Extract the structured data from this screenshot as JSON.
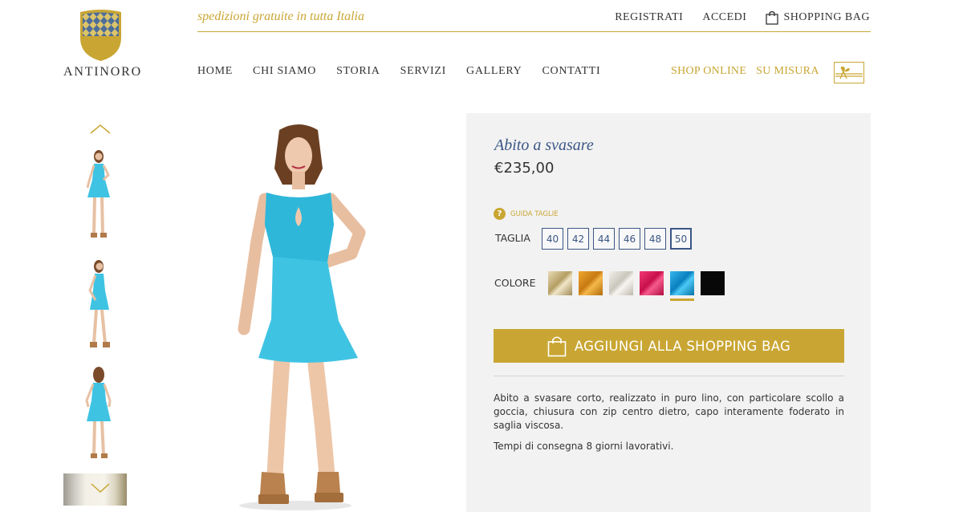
{
  "brand": {
    "name": "ANTINORO"
  },
  "topbar": {
    "promo": "spedizioni gratuite in tutta Italia",
    "links": {
      "register": "REGISTRATI",
      "login": "ACCEDI",
      "bag": "SHOPPING BAG"
    }
  },
  "nav": {
    "items": [
      "HOME",
      "CHI SIAMO",
      "STORIA",
      "SERVIZI",
      "GALLERY",
      "CONTATTI"
    ],
    "right": [
      "SHOP ONLINE",
      "SU MISURA"
    ],
    "gift_icon": "gift-icon"
  },
  "thumbnails": {
    "up_icon": "chevron-up-icon",
    "down_icon": "chevron-down-icon",
    "items": [
      "front-view",
      "side-view",
      "back-view",
      "fabric-detail"
    ]
  },
  "product": {
    "title": "Abito a svasare",
    "price": "€235,00",
    "size_guide": "GUIDA TAGLIE",
    "size_label": "TAGLIA",
    "sizes": [
      "40",
      "42",
      "44",
      "46",
      "48",
      "50"
    ],
    "selected_size": "50",
    "color_label": "COLORE",
    "colors": [
      "#c9b98d",
      "#d18b1f",
      "#d9d6cd",
      "#e0245e",
      "#1aa3db",
      "#0a0a0a"
    ],
    "selected_color_index": 4,
    "add_to_bag": "AGGIUNGI ALLA SHOPPING BAG",
    "description": "Abito a svasare corto, realizzato in puro lino, con particolare scollo a goccia, chiusura con zip centro dietro, capo interamente foderato in saglia viscosa.",
    "delivery": "Tempi di consegna 8 giorni lavorativi."
  },
  "colors": {
    "gold": "#c9a633",
    "navy": "#3a5685",
    "panel": "#f2f2f2",
    "dress": "#3fc3e3"
  }
}
